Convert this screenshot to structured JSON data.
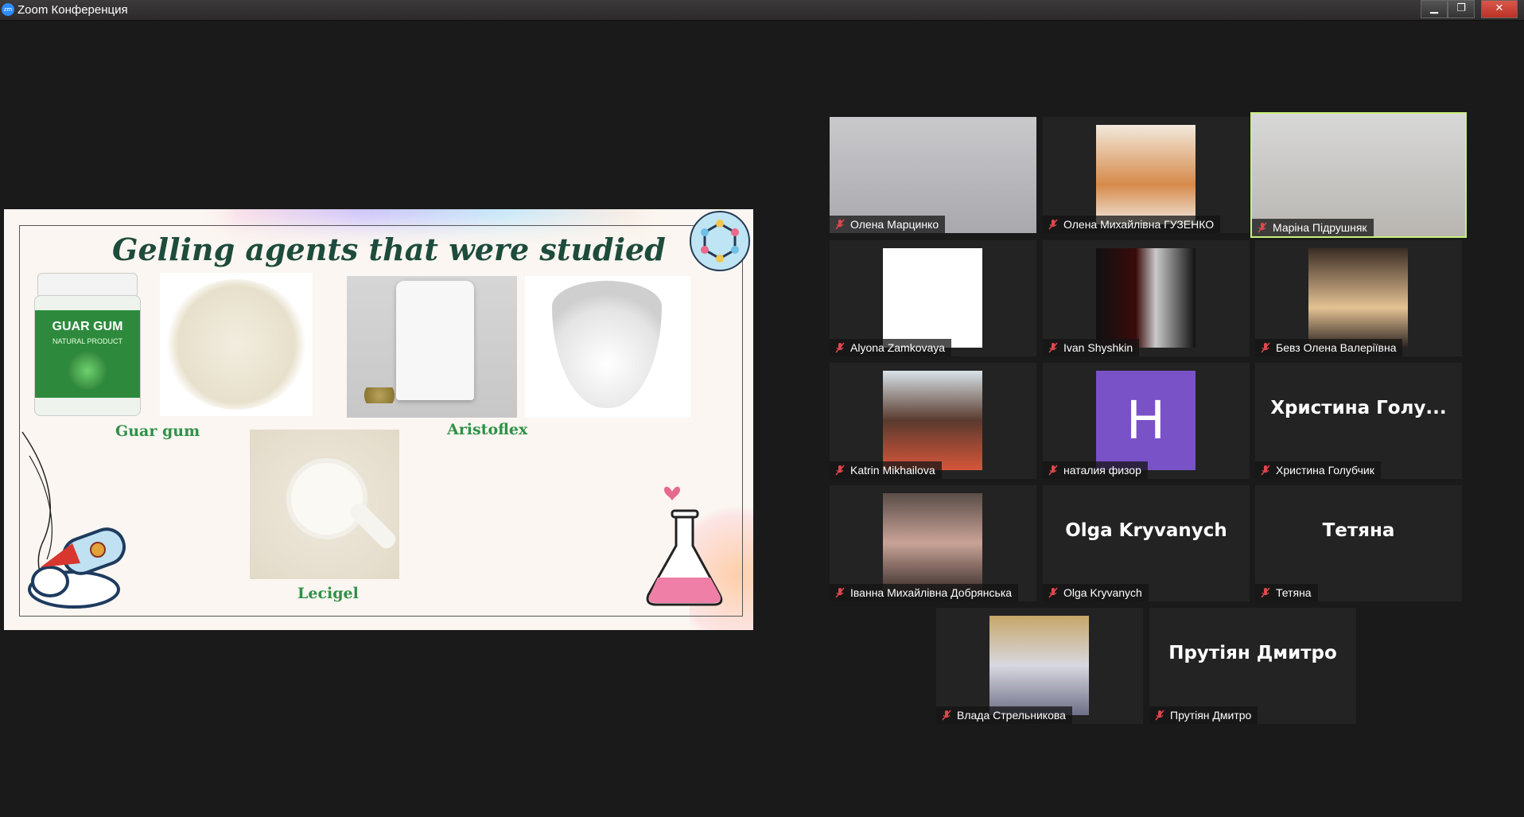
{
  "window": {
    "title": "Zoom Конференция",
    "app_icon_text": "zm",
    "buttons": {
      "minimize": "▁",
      "maximize": "❐",
      "close": "✕"
    }
  },
  "slide": {
    "title": "Gelling agents that were studied",
    "items": [
      {
        "caption": "Guar gum",
        "jar_label": "GUAR GUM",
        "jar_sub": "NATURAL PRODUCT"
      },
      {
        "caption": "Aristoflex"
      },
      {
        "caption": "Lecigel"
      }
    ]
  },
  "participants": [
    {
      "name": "Олена Марцинко",
      "video": "photo",
      "active": false
    },
    {
      "name": "Олена Михайлівна ГУЗЕНКО",
      "video": "photo",
      "active": false
    },
    {
      "name": "Маріна Підрушняк",
      "video": "photo",
      "active": true
    },
    {
      "name": "Alyona Zamkovaya",
      "video": "photo",
      "active": false
    },
    {
      "name": "Ivan Shyshkin",
      "video": "photo",
      "active": false
    },
    {
      "name": "Бевз Олена Валеріївна",
      "video": "photo",
      "active": false
    },
    {
      "name": "Katrin Mikhailova",
      "video": "photo",
      "active": false
    },
    {
      "name": "наталия физор",
      "video": "letter",
      "letter": "H",
      "active": false
    },
    {
      "name": "Христина Голубчик",
      "video": "text",
      "display": "Христина  Голу...",
      "active": false
    },
    {
      "name": "Іванна Михайлівна Добрянська",
      "video": "photo",
      "active": false
    },
    {
      "name": "Olga Kryvanych",
      "video": "text",
      "display": "Olga Kryvanych",
      "active": false
    },
    {
      "name": "Тетяна",
      "video": "text",
      "display": "Тетяна",
      "active": false
    },
    {
      "name": "Влада Стрельникова",
      "video": "photo",
      "active": false
    },
    {
      "name": "Прутіян Дмитро",
      "video": "text",
      "display": "Прутіян Дмитро",
      "active": false
    }
  ],
  "colors": {
    "active_speaker": "#c8f07d",
    "muted_icon": "#e0474c",
    "slide_title": "#1d4b3c",
    "caption": "#2f9148"
  }
}
